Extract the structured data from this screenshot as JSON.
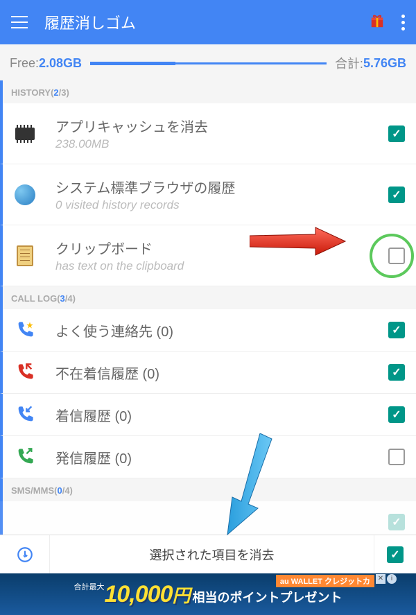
{
  "header": {
    "title": "履歴消しゴム"
  },
  "storage": {
    "free_label": "Free: ",
    "free_value": "2.08GB",
    "total_label": "合計: ",
    "total_value": "5.76GB"
  },
  "sections": [
    {
      "name": "HISTORY",
      "count": "2",
      "total": "/3)",
      "items": [
        {
          "title": "アプリキャッシュを消去",
          "sub": "238.00MB",
          "checked": true,
          "icon": "chip"
        },
        {
          "title": "システム標準ブラウザの履歴",
          "sub": "0 visited history records",
          "checked": true,
          "icon": "globe"
        },
        {
          "title": "クリップボード",
          "sub": "has text on the clipboard",
          "checked": false,
          "icon": "clipboard",
          "highlight": true
        }
      ]
    },
    {
      "name": "CALL LOG",
      "count": "3",
      "total": "/4)",
      "items": [
        {
          "title": "よく使う連絡先 (0)",
          "checked": true,
          "icon": "phone-star"
        },
        {
          "title": "不在着信履歴 (0)",
          "checked": true,
          "icon": "phone-missed"
        },
        {
          "title": "着信履歴 (0)",
          "checked": true,
          "icon": "phone-in"
        },
        {
          "title": "発信履歴 (0)",
          "checked": false,
          "icon": "phone-out"
        }
      ]
    },
    {
      "name": "SMS/MMS",
      "count": "0",
      "total": "/4)",
      "items": []
    }
  ],
  "bottom": {
    "clear_label": "選択された項目を消去"
  },
  "ad": {
    "pre": "合計最大",
    "amount": "10,000",
    "unit": "円",
    "tail": "相当のポイントプレゼント",
    "tag": "au WALLET クレジットカ"
  }
}
